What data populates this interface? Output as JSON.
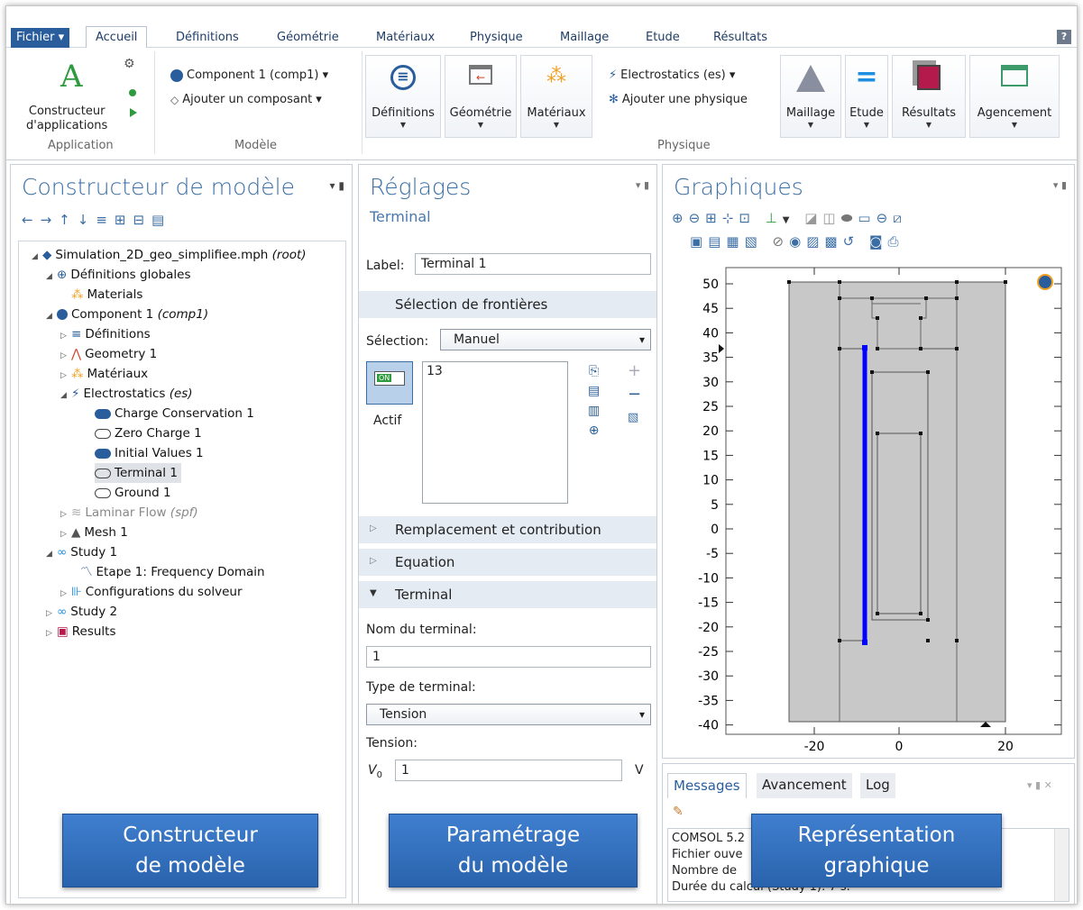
{
  "menu": {
    "file": "Fichier ▾",
    "tabs": [
      "Accueil",
      "Définitions",
      "Géométrie",
      "Matériaux",
      "Physique",
      "Maillage",
      "Etude",
      "Résultats"
    ],
    "help": "?"
  },
  "ribbon": {
    "app_builder_line1": "Constructeur",
    "app_builder_line2": "d'applications",
    "group_application": "Application",
    "component_dropdown": "Component 1 (comp1) ▾",
    "add_component": "Ajouter un composant ▾",
    "group_model": "Modèle",
    "btn_definitions": "Définitions",
    "btn_geometry": "Géométrie",
    "btn_materials": "Matériaux",
    "physics_dropdown": "Electrostatics (es) ▾",
    "add_physics": "Ajouter une physique",
    "group_physics": "Physique",
    "btn_mesh": "Maillage",
    "btn_study": "Etude",
    "btn_results": "Résultats",
    "btn_layout": "Agencement"
  },
  "model_builder": {
    "title": "Constructeur de modèle",
    "tree": [
      {
        "label": "Simulation_2D_geo_simplifiee.mph",
        "suffix": "(root)"
      },
      {
        "label": "Définitions globales",
        "suffix": ""
      },
      {
        "label": "Materials",
        "suffix": ""
      },
      {
        "label": "Component 1",
        "suffix": "(comp1)"
      },
      {
        "label": "Définitions",
        "suffix": ""
      },
      {
        "label": "Geometry 1",
        "suffix": ""
      },
      {
        "label": "Matériaux",
        "suffix": ""
      },
      {
        "label": "Electrostatics",
        "suffix": "(es)"
      },
      {
        "label": "Charge Conservation 1",
        "suffix": ""
      },
      {
        "label": "Zero Charge 1",
        "suffix": ""
      },
      {
        "label": "Initial Values 1",
        "suffix": ""
      },
      {
        "label": "Terminal 1",
        "suffix": ""
      },
      {
        "label": "Ground 1",
        "suffix": ""
      },
      {
        "label": "Laminar Flow",
        "suffix": "(spf)"
      },
      {
        "label": "Mesh 1",
        "suffix": ""
      },
      {
        "label": "Study 1",
        "suffix": ""
      },
      {
        "label": "Etape 1: Frequency Domain",
        "suffix": ""
      },
      {
        "label": "Configurations du solveur",
        "suffix": ""
      },
      {
        "label": "Study 2",
        "suffix": ""
      },
      {
        "label": "Results",
        "suffix": ""
      }
    ]
  },
  "settings": {
    "title": "Réglages",
    "subtitle": "Terminal",
    "label_caption": "Label:",
    "label_value": "Terminal 1",
    "boundary_section": "Sélection de frontières",
    "selection_caption": "Sélection:",
    "selection_value": "Manuel",
    "selection_list": "13",
    "toggle_on": "ON",
    "active_label": "Actif",
    "section_override": "Remplacement et contribution",
    "section_equation": "Equation",
    "section_terminal": "Terminal",
    "terminal_name_caption": "Nom du terminal:",
    "terminal_name_value": "1",
    "terminal_type_caption": "Type de terminal:",
    "terminal_type_value": "Tension",
    "voltage_caption": "Tension:",
    "voltage_symbol": "V",
    "voltage_sub": "0",
    "voltage_value": "1",
    "voltage_unit": "V"
  },
  "graphics": {
    "title": "Graphiques",
    "y_ticks": [
      "50",
      "45",
      "40",
      "35",
      "30",
      "25",
      "20",
      "15",
      "10",
      "5",
      "0",
      "-5",
      "-10",
      "-15",
      "-20",
      "-25",
      "-30",
      "-35",
      "-40"
    ],
    "x_ticks": [
      "-20",
      "0",
      "20"
    ]
  },
  "messages": {
    "tabs": [
      "Messages",
      "Avancement",
      "Log"
    ],
    "lines": [
      "COMSOL 5.2",
      "Fichier ouve",
      "Nombre de",
      "Durée du calcul (Study 1): 7 s."
    ]
  },
  "callouts": {
    "model_builder": [
      "Constructeur",
      "de modèle"
    ],
    "settings": [
      "Paramétrage",
      "du modèle"
    ],
    "graphics": [
      "Représentation",
      "graphique"
    ]
  },
  "colors": {
    "accent": "#2a5d9c",
    "highlight": "#0000ff",
    "geometry_fill": "#c8c8c8"
  }
}
